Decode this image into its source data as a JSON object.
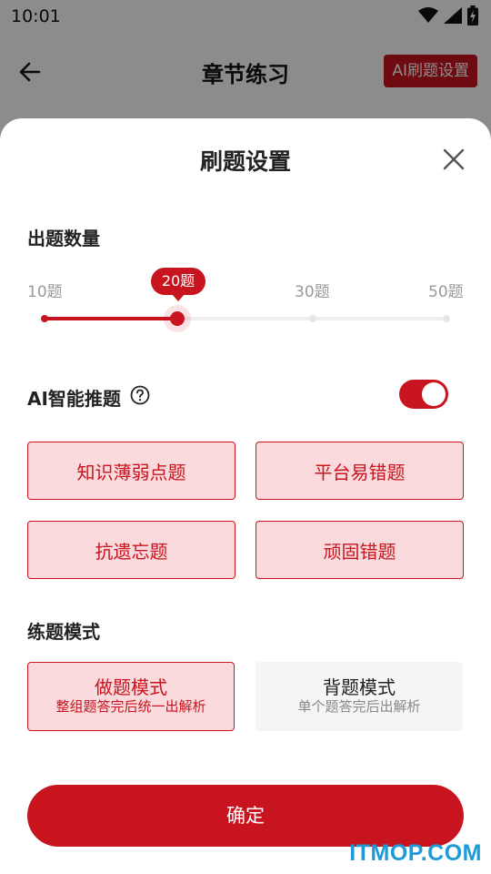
{
  "status_bar": {
    "time": "10:01"
  },
  "nav": {
    "title": "章节练习",
    "ai_button_label": "AI刷题设置"
  },
  "sheet": {
    "title": "刷题设置",
    "question_count": {
      "title": "出题数量",
      "ticks": [
        "10题",
        "30题",
        "50题"
      ],
      "selected_label": "20题",
      "selected_value": 20,
      "range": [
        10,
        50
      ]
    },
    "ai": {
      "label": "AI智能推题",
      "enabled": true
    },
    "options": [
      "知识薄弱点题",
      "平台易错题",
      "抗遗忘题",
      "顽固错题"
    ],
    "practice_mode": {
      "title": "练题模式",
      "modes": [
        {
          "title": "做题模式",
          "subtitle": "整组题答完后统一出解析"
        },
        {
          "title": "背题模式",
          "subtitle": "单个题答完后出解析"
        }
      ]
    },
    "confirm_label": "确定"
  },
  "watermark": "ITMOP.COM",
  "colors": {
    "accent": "#c8141e",
    "tile_bg": "#fadadd",
    "watermark": "#1e9ad6"
  }
}
